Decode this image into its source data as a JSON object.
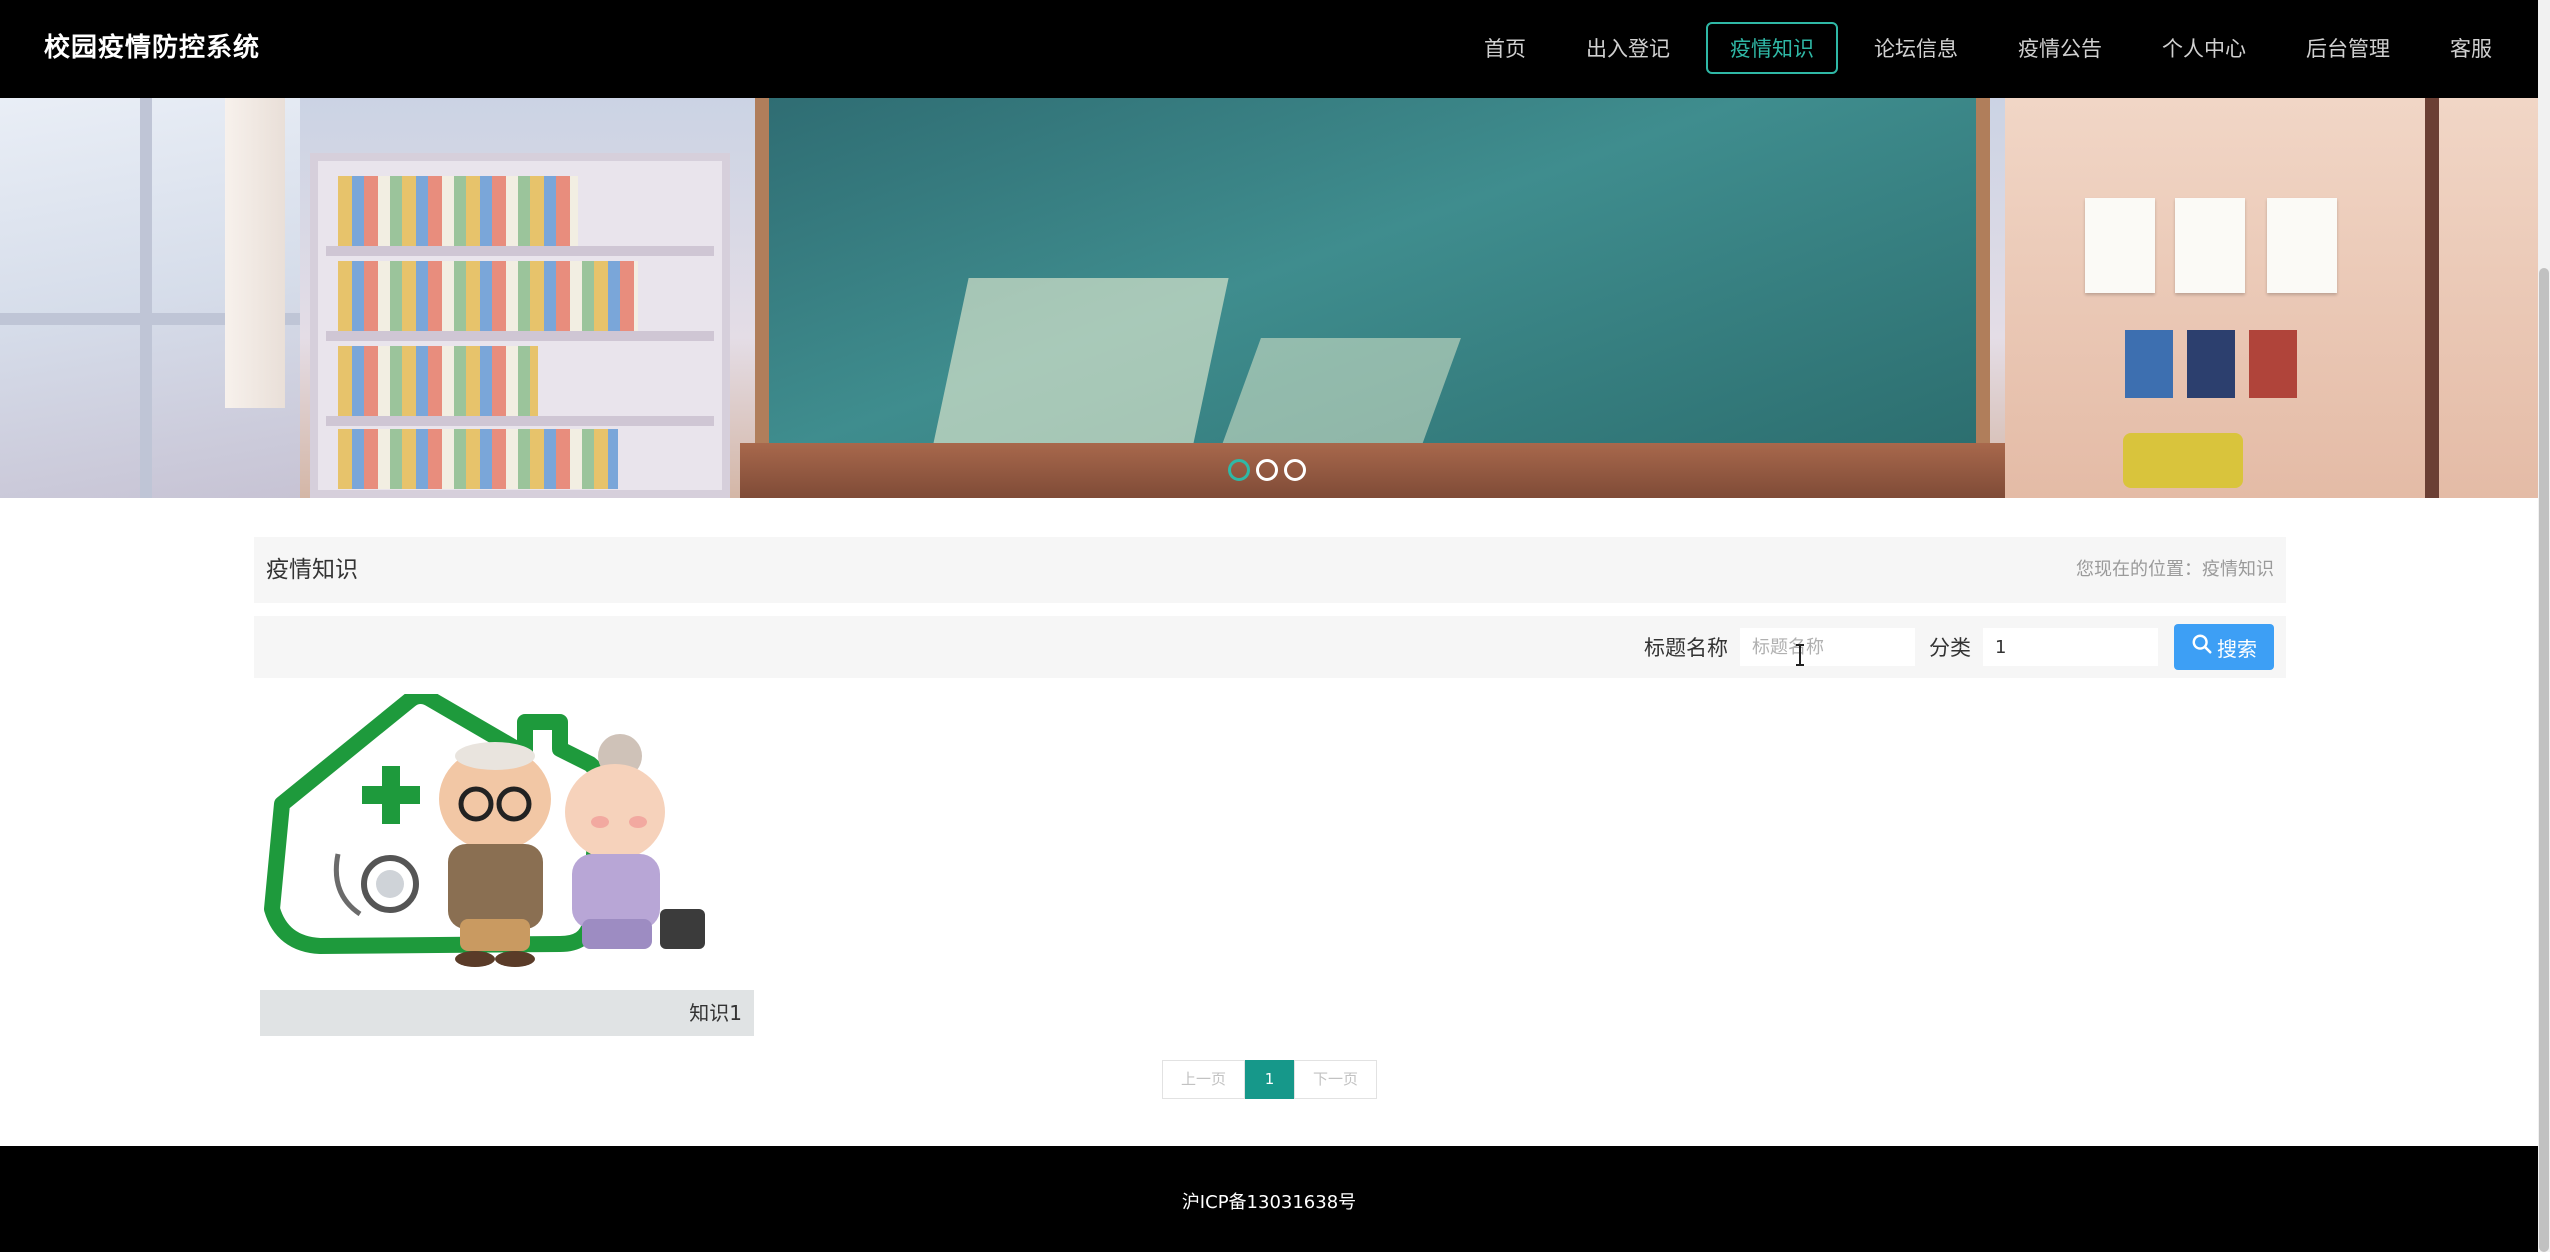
{
  "header": {
    "site_title": "校园疫情防控系统",
    "nav": [
      {
        "label": "首页",
        "active": false
      },
      {
        "label": "出入登记",
        "active": false
      },
      {
        "label": "疫情知识",
        "active": true
      },
      {
        "label": "论坛信息",
        "active": false
      },
      {
        "label": "疫情公告",
        "active": false
      },
      {
        "label": "个人中心",
        "active": false
      },
      {
        "label": "后台管理",
        "active": false
      },
      {
        "label": "客服",
        "active": false
      }
    ]
  },
  "banner": {
    "slide_count": 3,
    "active_slide": 1
  },
  "page": {
    "title": "疫情知识",
    "breadcrumb": "您现在的位置：疫情知识"
  },
  "search": {
    "title_label": "标题名称",
    "title_placeholder": "标题名称",
    "title_value": "",
    "category_label": "分类",
    "category_value": "1",
    "button_label": "搜索",
    "button_icon": "search-icon"
  },
  "cards": [
    {
      "caption": "知识1"
    }
  ],
  "pagination": {
    "prev_label": "上一页",
    "current_page": "1",
    "next_label": "下一页"
  },
  "footer": {
    "icp": "沪ICP备13031638号"
  },
  "colors": {
    "accent": "#2fb8a6",
    "search_button": "#3d9ff5",
    "page_active": "#16988a",
    "header_bg": "#000000"
  }
}
